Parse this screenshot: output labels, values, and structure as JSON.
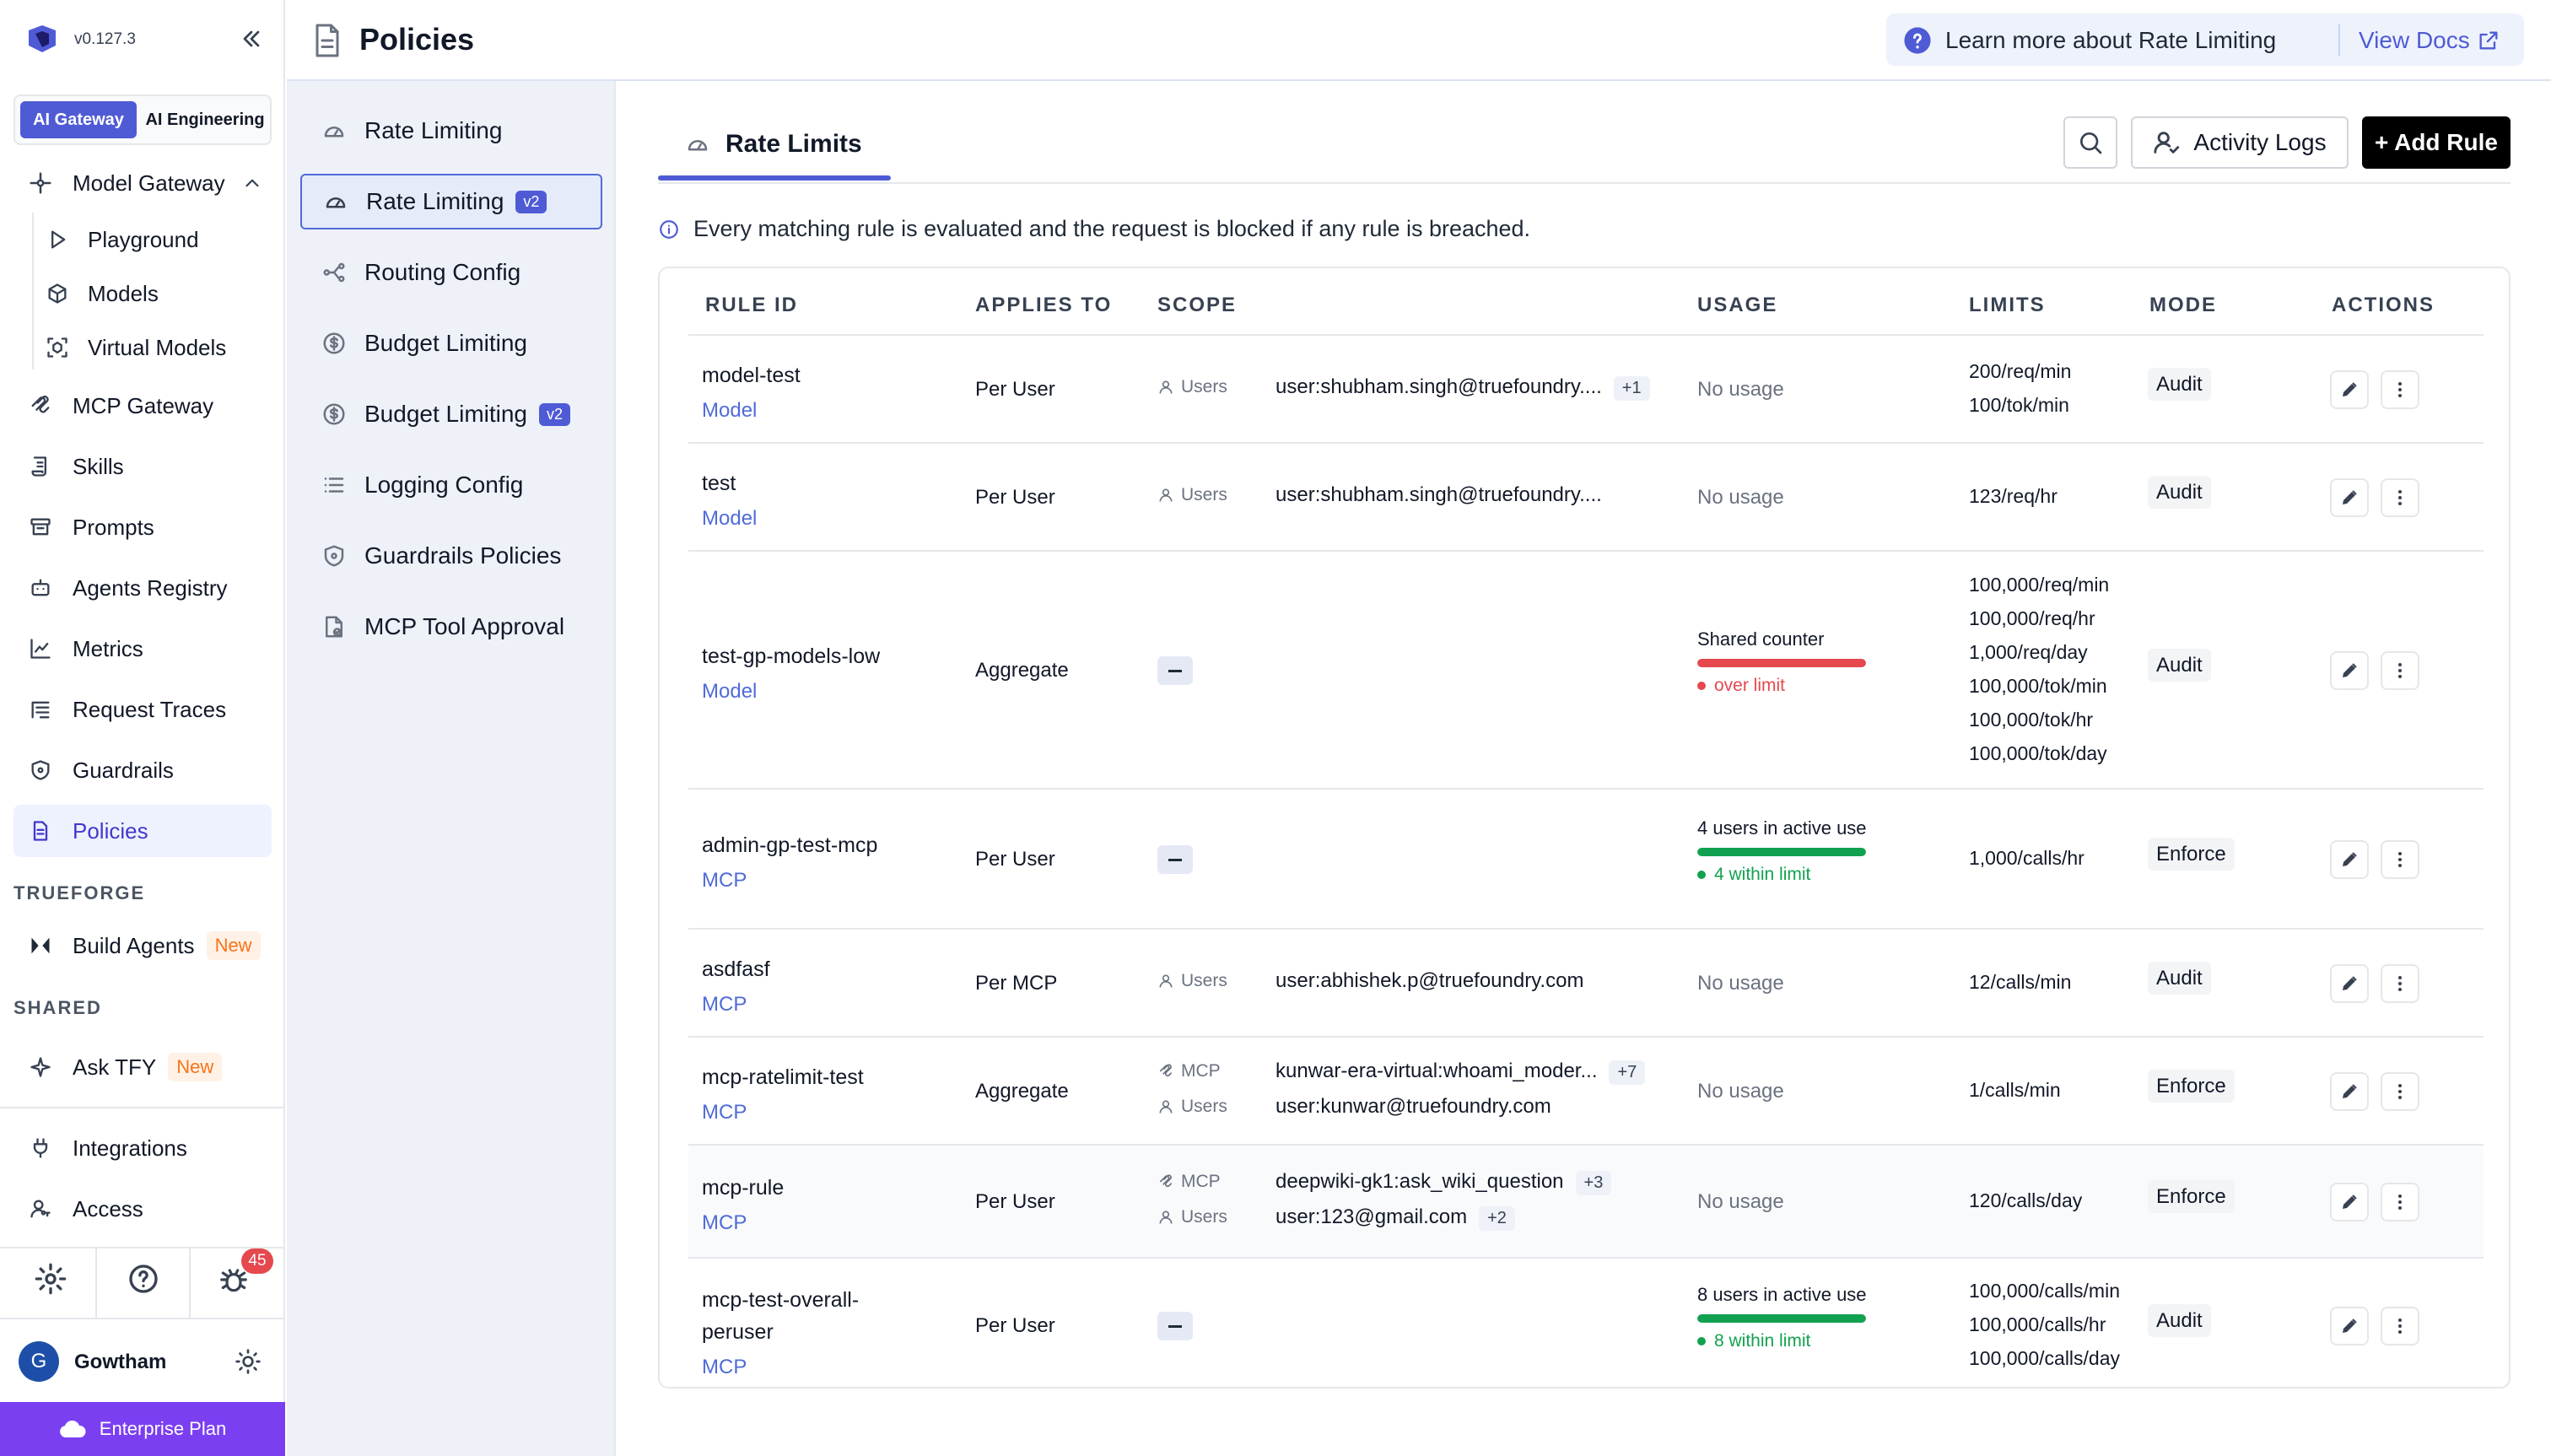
{
  "app": {
    "version": "v0.127.3"
  },
  "tabs": {
    "ai_gateway": "AI Gateway",
    "ai_engineering": "AI Engineering"
  },
  "sidebar": {
    "model_gateway": "Model Gateway",
    "sub": [
      "Playground",
      "Models",
      "Virtual Models"
    ],
    "items": [
      "MCP Gateway",
      "Skills",
      "Prompts",
      "Agents Registry",
      "Metrics",
      "Request Traces",
      "Guardrails",
      "Policies"
    ],
    "trueforge_label": "TRUEFORGE",
    "build_agents": "Build Agents",
    "shared_label": "SHARED",
    "ask_tfy": "Ask TFY",
    "new_badge": "New",
    "integrations": "Integrations",
    "access": "Access",
    "notif_count": "45",
    "user_initial": "G",
    "user_name": "Gowtham",
    "plan": "Enterprise Plan"
  },
  "header": {
    "title": "Policies",
    "help_text": "Learn more about Rate Limiting",
    "docs_link": "View Docs"
  },
  "policy_menu": [
    {
      "label": "Rate Limiting",
      "badge": ""
    },
    {
      "label": "Rate Limiting",
      "badge": "v2"
    },
    {
      "label": "Routing Config",
      "badge": ""
    },
    {
      "label": "Budget Limiting",
      "badge": ""
    },
    {
      "label": "Budget Limiting",
      "badge": "v2"
    },
    {
      "label": "Logging Config",
      "badge": ""
    },
    {
      "label": "Guardrails Policies",
      "badge": ""
    },
    {
      "label": "MCP Tool Approval",
      "badge": ""
    }
  ],
  "main": {
    "tab": "Rate Limits",
    "activity_logs": "Activity Logs",
    "add_rule": "+ Add Rule",
    "info": "Every matching rule is evaluated and the request is blocked if any rule is breached.",
    "columns": [
      "RULE ID",
      "APPLIES TO",
      "SCOPE",
      "USAGE",
      "LIMITS",
      "MODE",
      "ACTIONS"
    ]
  },
  "rows": [
    {
      "id": "model-test",
      "type": "Model",
      "applies": "Per User",
      "scope": [
        {
          "label": "Users",
          "value": "user:shubham.singh@truefoundry....",
          "chip": "+1"
        }
      ],
      "usage": {
        "text": "No usage"
      },
      "limits": [
        "200/req/min",
        "100/tok/min"
      ],
      "mode": "Audit"
    },
    {
      "id": "test",
      "type": "Model",
      "applies": "Per User",
      "scope": [
        {
          "label": "Users",
          "value": "user:shubham.singh@truefoundry....",
          "chip": ""
        }
      ],
      "usage": {
        "text": "No usage"
      },
      "limits": [
        "123/req/hr"
      ],
      "mode": "Audit"
    },
    {
      "id": "test-gp-models-low",
      "type": "Model",
      "applies": "Aggregate",
      "scope": [],
      "usage": {
        "title": "Shared counter",
        "status": "over limit",
        "color": "#e5484d",
        "fill": 1.0
      },
      "limits": [
        "100,000/req/min",
        "100,000/req/hr",
        "1,000/req/day",
        "100,000/tok/min",
        "100,000/tok/hr",
        "100,000/tok/day"
      ],
      "mode": "Audit"
    },
    {
      "id": "admin-gp-test-mcp",
      "type": "MCP",
      "applies": "Per User",
      "scope": [],
      "usage": {
        "title": "4 users in active use",
        "status": "4 within limit",
        "color": "#12a150",
        "fill": 1.0
      },
      "limits": [
        "1,000/calls/hr"
      ],
      "mode": "Enforce"
    },
    {
      "id": "asdfasf",
      "type": "MCP",
      "applies": "Per MCP",
      "scope": [
        {
          "label": "Users",
          "value": "user:abhishek.p@truefoundry.com",
          "chip": ""
        }
      ],
      "usage": {
        "text": "No usage"
      },
      "limits": [
        "12/calls/min"
      ],
      "mode": "Audit"
    },
    {
      "id": "mcp-ratelimit-test",
      "type": "MCP",
      "applies": "Aggregate",
      "scope": [
        {
          "label": "MCP",
          "value": "kunwar-era-virtual:whoami_moder...",
          "chip": "+7"
        },
        {
          "label": "Users",
          "value": "user:kunwar@truefoundry.com",
          "chip": ""
        }
      ],
      "usage": {
        "text": "No usage"
      },
      "limits": [
        "1/calls/min"
      ],
      "mode": "Enforce"
    },
    {
      "id": "mcp-rule",
      "type": "MCP",
      "applies": "Per User",
      "scope": [
        {
          "label": "MCP",
          "value": "deepwiki-gk1:ask_wiki_question",
          "chip": "+3"
        },
        {
          "label": "Users",
          "value": "user:123@gmail.com",
          "chip": "+2"
        }
      ],
      "usage": {
        "text": "No usage"
      },
      "limits": [
        "120/calls/day"
      ],
      "mode": "Enforce"
    },
    {
      "id": "mcp-test-overall-\nperuser",
      "type": "MCP",
      "applies": "Per User",
      "scope": [],
      "usage": {
        "title": "8 users in active use",
        "status": "8 within limit",
        "color": "#12a150",
        "fill": 1.0
      },
      "limits": [
        "100,000/calls/min",
        "100,000/calls/hr",
        "100,000/calls/day"
      ],
      "mode": "Audit"
    }
  ]
}
